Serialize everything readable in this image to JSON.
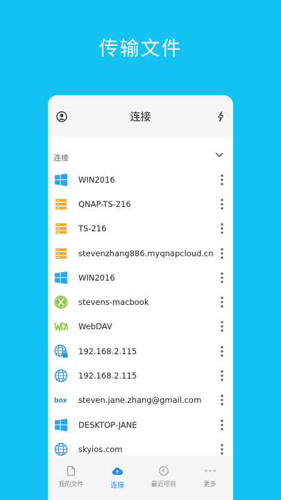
{
  "hero": {
    "title": "传输文件"
  },
  "topbar": {
    "title": "连接"
  },
  "section": {
    "label": "连接"
  },
  "connections": [
    {
      "name": "WIN2016",
      "icon": "windows-icon"
    },
    {
      "name": "QNAP-TS-216",
      "icon": "nas-server-icon"
    },
    {
      "name": "TS-216",
      "icon": "nas-server-icon"
    },
    {
      "name": "stevenzhang886.myqnapcloud.cn",
      "icon": "nas-server-icon"
    },
    {
      "name": "WIN2016",
      "icon": "windows-icon"
    },
    {
      "name": "stevens-macbook",
      "icon": "macos-x-icon"
    },
    {
      "name": "WebDAV",
      "icon": "webdav-icon"
    },
    {
      "name": "192.168.2.115",
      "icon": "globe-lock-icon"
    },
    {
      "name": "192.168.2.115",
      "icon": "globe-icon"
    },
    {
      "name": "steven.jane.zhang@gmail.com",
      "icon": "box-icon"
    },
    {
      "name": "DESKTOP-JANE",
      "icon": "windows-icon"
    },
    {
      "name": "skyios.com",
      "icon": "globe-icon"
    }
  ],
  "tabs": [
    {
      "label": "我的文件",
      "icon": "document-icon"
    },
    {
      "label": "连接",
      "icon": "cloud-icon"
    },
    {
      "label": "最近项目",
      "icon": "clock-icon"
    },
    {
      "label": "更多",
      "icon": "more-dots-icon"
    }
  ],
  "colors": {
    "background": "#14c3f2",
    "accent": "#1e8de6",
    "nas": "#f5a623",
    "windows": "#2aa4f4",
    "mac": "#8cc63f"
  }
}
